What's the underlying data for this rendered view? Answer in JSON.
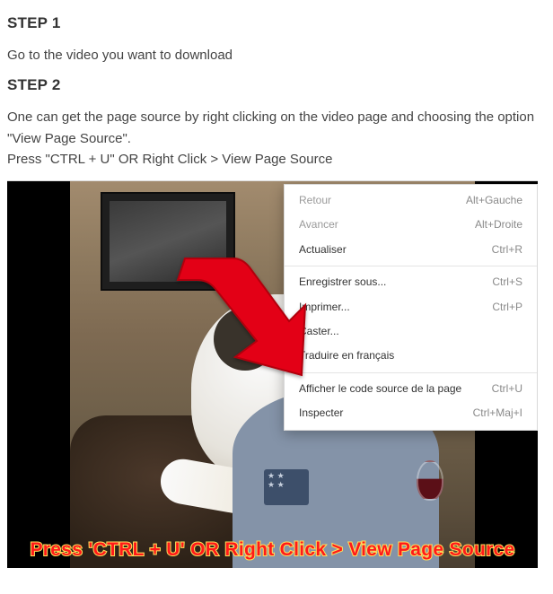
{
  "step1": {
    "heading": "STEP 1",
    "text": "Go to the video you want to download"
  },
  "step2": {
    "heading": "STEP 2",
    "text_line1": "One can get the page source by right clicking on the video page and choosing the option \"View Page Source\".",
    "text_line2": "Press \"CTRL + U\" OR Right Click > View Page Source"
  },
  "context_menu": {
    "items": [
      {
        "label": "Retour",
        "shortcut": "Alt+Gauche",
        "dim": true
      },
      {
        "label": "Avancer",
        "shortcut": "Alt+Droite",
        "dim": true
      },
      {
        "label": "Actualiser",
        "shortcut": "Ctrl+R",
        "dim": false
      }
    ],
    "items2": [
      {
        "label": "Enregistrer sous...",
        "shortcut": "Ctrl+S"
      },
      {
        "label": "Imprimer...",
        "shortcut": "Ctrl+P"
      },
      {
        "label": "Caster...",
        "shortcut": ""
      },
      {
        "label": "Traduire en français",
        "shortcut": ""
      }
    ],
    "items3": [
      {
        "label": "Afficher le code source de la page",
        "shortcut": "Ctrl+U"
      },
      {
        "label": "Inspecter",
        "shortcut": "Ctrl+Maj+I"
      }
    ]
  },
  "caption": "Press 'CTRL + U' OR Right Click > View Page Source",
  "colors": {
    "arrow": "#e30613",
    "caption_fill": "#ff1a1a",
    "caption_stroke": "#ffe05a"
  }
}
